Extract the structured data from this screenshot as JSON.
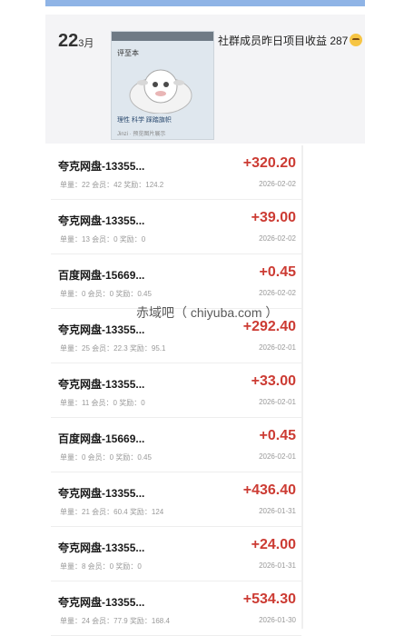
{
  "post": {
    "day": "22",
    "month": "3月",
    "thumb_label": "评至本",
    "thumb_caption": "理性 科学 踩踏旗帜",
    "thumb_footer": "Jinzi · 预览图片展示",
    "title": "社群成员昨日项目收益 287",
    "emoji_icon": "grimacing-face-icon"
  },
  "records": [
    {
      "name": "夸克网盘-13355...",
      "amount": "+320.20",
      "meta": "单量：22 会员：42 奖励：124.2",
      "date": "2026-02-02"
    },
    {
      "name": "夸克网盘-13355...",
      "amount": "+39.00",
      "meta": "单量：13 会员：0 奖励：0",
      "date": "2026-02-02"
    },
    {
      "name": "百度网盘-15669...",
      "amount": "+0.45",
      "meta": "单量：0 会员：0 奖励：0.45",
      "date": "2026-02-02"
    },
    {
      "name": "夸克网盘-13355...",
      "amount": "+292.40",
      "meta": "单量：25 会员：22.3 奖励：95.1",
      "date": "2026-02-01"
    },
    {
      "name": "夸克网盘-13355...",
      "amount": "+33.00",
      "meta": "单量：11 会员：0 奖励：0",
      "date": "2026-02-01"
    },
    {
      "name": "百度网盘-15669...",
      "amount": "+0.45",
      "meta": "单量：0 会员：0 奖励：0.45",
      "date": "2026-02-01"
    },
    {
      "name": "夸克网盘-13355...",
      "amount": "+436.40",
      "meta": "单量：21 会员：60.4 奖励：124",
      "date": "2026-01-31"
    },
    {
      "name": "夸克网盘-13355...",
      "amount": "+24.00",
      "meta": "单量：8 会员：0 奖励：0",
      "date": "2026-01-31"
    },
    {
      "name": "夸克网盘-13355...",
      "amount": "+534.30",
      "meta": "单量：24 会员：77.9 奖励：168.4",
      "date": "2026-01-30"
    }
  ],
  "watermark": "赤域吧（ chiyuba.com ）",
  "colors": {
    "amount": "#cc3b33",
    "accent_bar": "#8fb4e6"
  }
}
